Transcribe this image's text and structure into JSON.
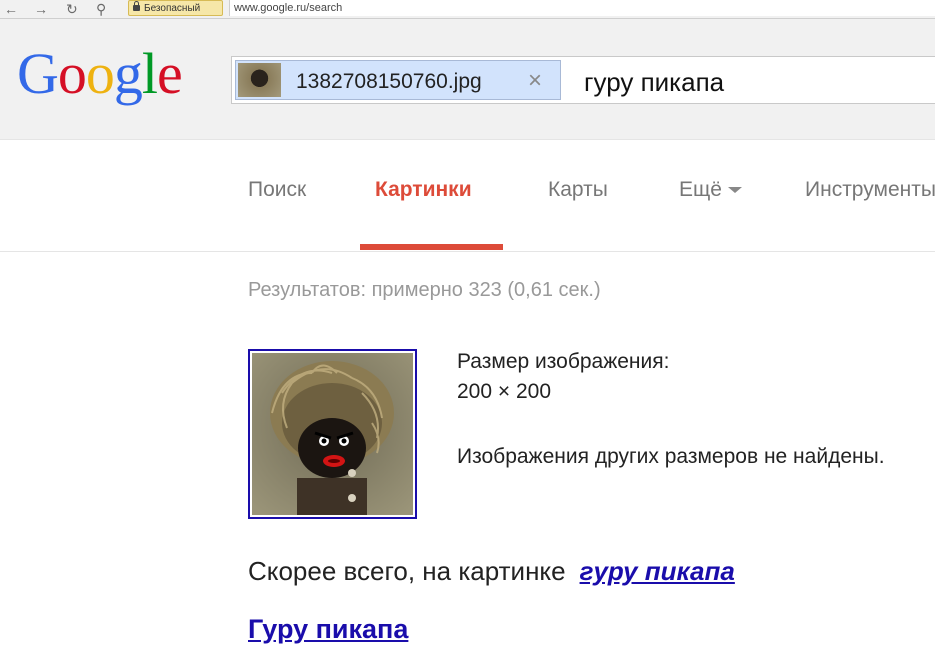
{
  "browser": {
    "secure_label": "Безопасный",
    "url": "www.google.ru/search"
  },
  "logo": {
    "letters": [
      "G",
      "o",
      "o",
      "g",
      "l",
      "e"
    ],
    "colors": [
      "#3369e8",
      "#d50f25",
      "#eeb211",
      "#3369e8",
      "#009925",
      "#d50f25"
    ]
  },
  "search": {
    "image_filename": "1382708150760.jpg",
    "close_glyph": "×",
    "query": "гуру пикапа"
  },
  "tabs": [
    {
      "label": "Поиск",
      "active": false
    },
    {
      "label": "Картинки",
      "active": true
    },
    {
      "label": "Карты",
      "active": false
    },
    {
      "label": "Ещё",
      "active": false
    },
    {
      "label": "Инструменты",
      "active": false
    }
  ],
  "stats": "Результатов: примерно 323 (0,61 сек.)",
  "image_info": {
    "size_label": "Размер изображения:",
    "size_value": "200 × 200",
    "no_other_sizes": "Изображения других размеров не найдены."
  },
  "best_guess": {
    "prefix": "Скорее всего, на картинке",
    "link": "гуру пикапа"
  },
  "result": {
    "title": "Гуру пикапа"
  },
  "colors": {
    "accent_red": "#dd4b39",
    "link_blue": "#1a0dab"
  }
}
